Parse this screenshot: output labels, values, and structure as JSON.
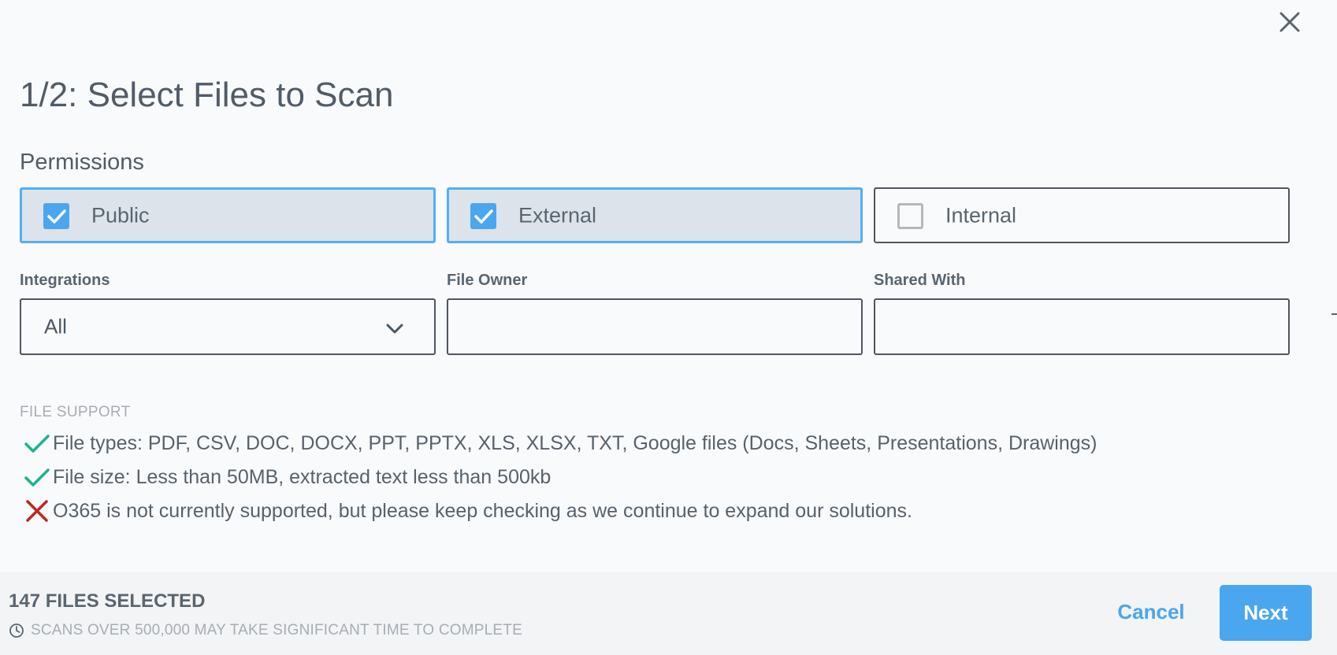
{
  "dialog": {
    "title": "1/2: Select Files to Scan",
    "close_icon": "close-icon"
  },
  "permissions": {
    "heading": "Permissions",
    "options": [
      {
        "label": "Public",
        "checked": true
      },
      {
        "label": "External",
        "checked": true
      },
      {
        "label": "Internal",
        "checked": false
      }
    ]
  },
  "filters": {
    "integrations": {
      "label": "Integrations",
      "value": "All"
    },
    "file_owner": {
      "label": "File Owner",
      "value": ""
    },
    "shared_with": {
      "label": "Shared With",
      "value": ""
    }
  },
  "file_support": {
    "heading": "FILE SUPPORT",
    "items": [
      {
        "status": "supported",
        "icon": "check-icon",
        "text": "File types: PDF, CSV, DOC, DOCX, PPT, PPTX, XLS, XLSX, TXT, Google files (Docs, Sheets, Presentations, Drawings)"
      },
      {
        "status": "supported",
        "icon": "check-icon",
        "text": "File size: Less than 50MB, extracted text less than 500kb"
      },
      {
        "status": "unsupported",
        "icon": "x-icon",
        "text": "O365 is not currently supported, but please keep checking as we continue to expand our solutions."
      }
    ]
  },
  "footer": {
    "selected_count": "147 FILES SELECTED",
    "warning": "SCANS OVER 500,000 MAY TAKE SIGNIFICANT TIME TO COMPLETE",
    "cancel_label": "Cancel",
    "next_label": "Next"
  },
  "colors": {
    "accent": "#4aa6ef",
    "check_green": "#1bb38f",
    "x_red": "#c0271f",
    "text": "#56626d",
    "muted": "#a7adb3"
  }
}
